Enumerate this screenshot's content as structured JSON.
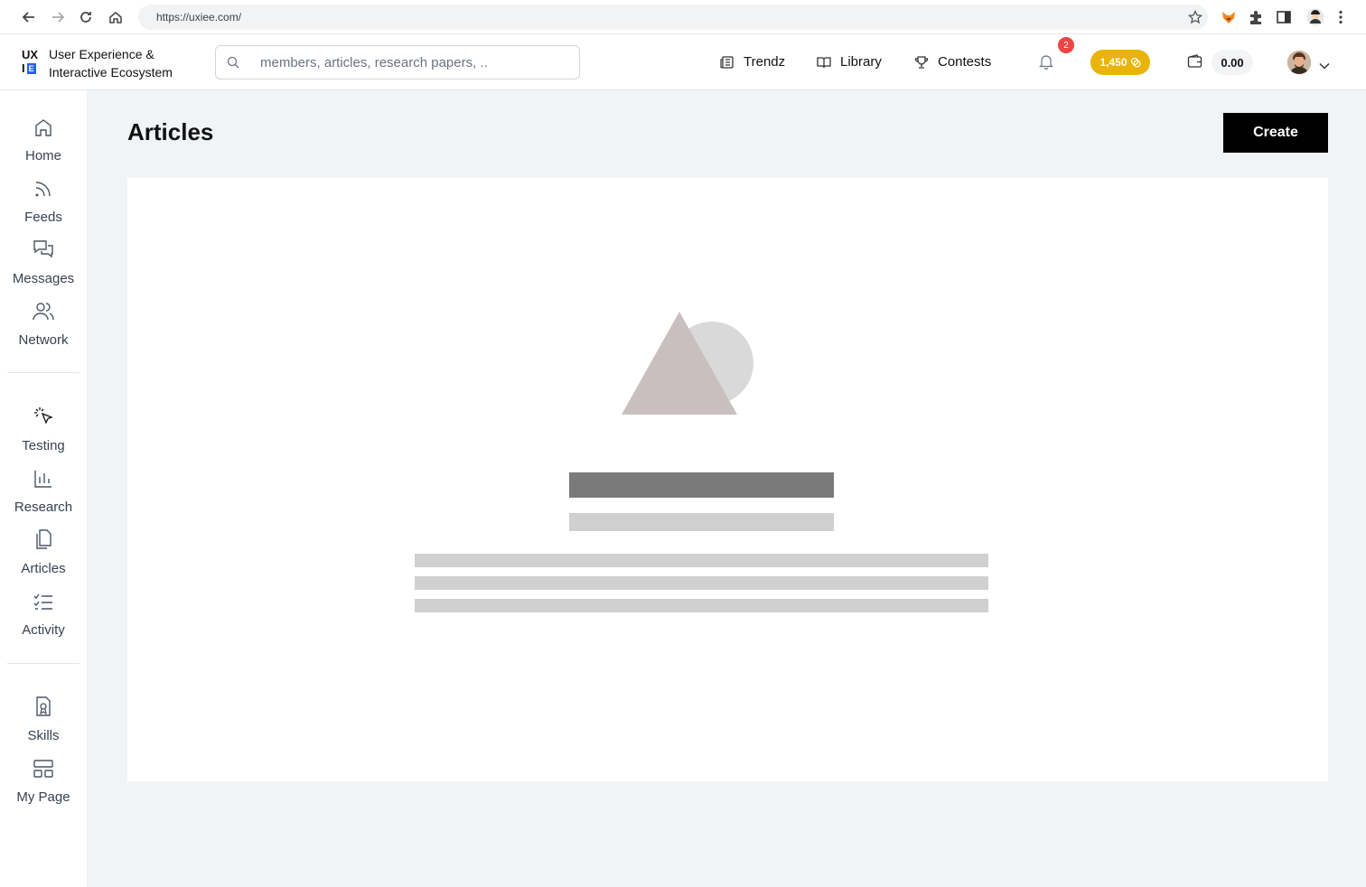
{
  "browser": {
    "url": "https://uxiee.com/"
  },
  "brand": {
    "mark_top": "UX",
    "mark_bottom_left": "I",
    "mark_bottom_right": "E",
    "line1": "User Experience &",
    "line2": "Interactive Ecosystem"
  },
  "search": {
    "placeholder": "members, articles, research papers, .."
  },
  "top_nav": [
    {
      "label": "Trendz",
      "icon": "newspaper-icon"
    },
    {
      "label": "Library",
      "icon": "book-icon"
    },
    {
      "label": "Contests",
      "icon": "trophy-icon"
    }
  ],
  "notifications": {
    "count": "2"
  },
  "coins": {
    "value": "1,450",
    "color": "#eab308"
  },
  "wallet": {
    "value": "0.00"
  },
  "sidebar": {
    "items": [
      {
        "label": "Home",
        "icon": "home-icon"
      },
      {
        "label": "Feeds",
        "icon": "rss-icon"
      },
      {
        "label": "Messages",
        "icon": "chat-icon"
      },
      {
        "label": "Network",
        "icon": "users-icon"
      },
      {
        "label": "Testing",
        "icon": "cursor-click-icon"
      },
      {
        "label": "Research",
        "icon": "bar-chart-icon"
      },
      {
        "label": "Articles",
        "icon": "documents-icon"
      },
      {
        "label": "Activity",
        "icon": "checklist-icon"
      },
      {
        "label": "Skills",
        "icon": "badge-file-icon"
      },
      {
        "label": "My Page",
        "icon": "layout-icon"
      }
    ]
  },
  "main": {
    "title": "Articles",
    "create_label": "Create"
  },
  "colors": {
    "accent": "#000000",
    "badge": "#ef4444",
    "brand_blue": "#2563eb"
  }
}
